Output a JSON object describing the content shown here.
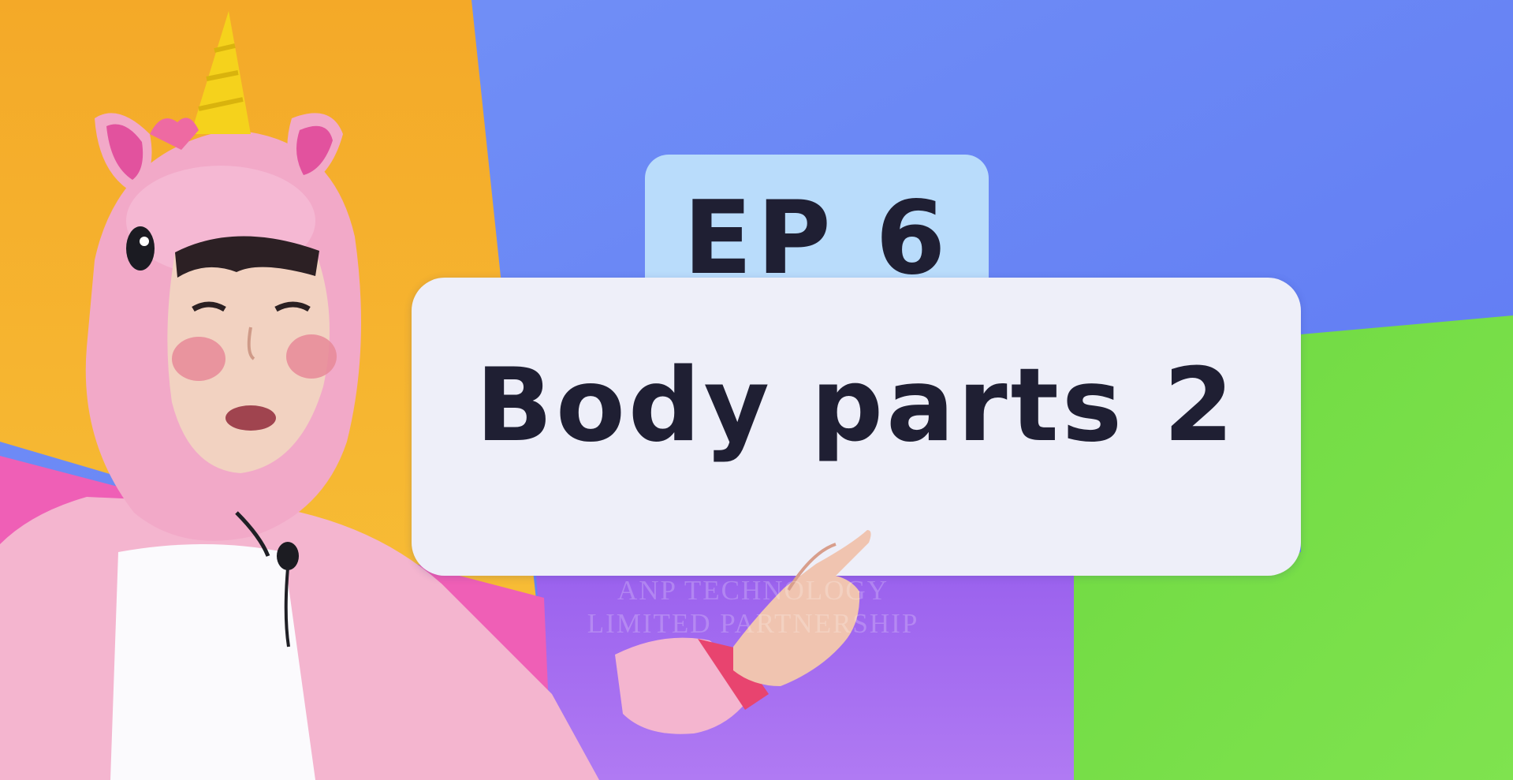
{
  "card": {
    "episode_label": "EP 6",
    "episode_title": "Body parts 2"
  },
  "watermark": {
    "line1": "ANP TECHNOLOGY",
    "line2": "LIMITED PARTNERSHIP"
  },
  "colors": {
    "orange_panel": "#f5b02c",
    "blue_panel": "#6a86f5",
    "green_panel": "#74dc46",
    "purple_panel": "#a36cf0",
    "pink_panel": "#ef5fb6",
    "card_fill": "#eeeff9",
    "tab_fill": "#b9dcfb",
    "title_text": "#1f1f33",
    "costume_pink": "#f4b5cf"
  },
  "icons": {
    "horn": "unicorn-horn-icon",
    "microphone": "lapel-microphone-icon"
  }
}
